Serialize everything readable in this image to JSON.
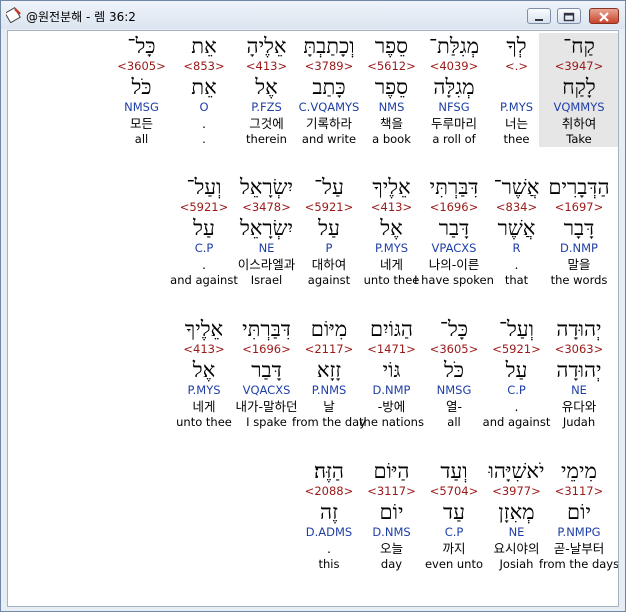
{
  "window": {
    "title": "@원전분해 - 렘 36:2",
    "buttons": [
      "minimize",
      "maximize",
      "close"
    ]
  },
  "rows": [
    [
      {
        "heb": "קַח־",
        "num": "<3947>",
        "lex": "לָקַח",
        "morph": "VQMMYS",
        "kor": "취하여",
        "eng": "Take",
        "highlight": true
      },
      {
        "heb": "לְךָ",
        "num": "<.>",
        "lex": "",
        "morph": "P.MYS",
        "kor": "너는",
        "eng": "thee"
      },
      {
        "heb": "מְגִלַּת־",
        "num": "<4039>",
        "lex": "מְגִלָּה",
        "morph": "NFSG",
        "kor": "두루마리",
        "eng": "a roll of"
      },
      {
        "heb": "סֵפֶר",
        "num": "<5612>",
        "lex": "סֵפֶר",
        "morph": "NMS",
        "kor": "책을",
        "eng": "a book"
      },
      {
        "heb": "וְכָתַבְתָּ",
        "num": "<3789>",
        "lex": "כָּתַב",
        "morph": "C.VQAMYS",
        "kor": "기록하라",
        "eng": "and write"
      },
      {
        "heb": "אֵלֶיהָ",
        "num": "<413>",
        "lex": "אֶל",
        "morph": "P.FZS",
        "kor": "그것에",
        "eng": "therein"
      },
      {
        "heb": "אֵת",
        "num": "<853>",
        "lex": "אֵת",
        "morph": "O",
        "kor": ".",
        "eng": "."
      },
      {
        "heb": "כָּל־",
        "num": "<3605>",
        "lex": "כֹּל",
        "morph": "NMSG",
        "kor": "모든",
        "eng": "all"
      }
    ],
    [
      {
        "heb": "הַדְּבָרִים",
        "num": "<1697>",
        "lex": "דָּבָר",
        "morph": "D.NMP",
        "kor": "말을",
        "eng": "the words"
      },
      {
        "heb": "אֲשֶׁר־",
        "num": "<834>",
        "lex": "אֲשֶׁר",
        "morph": "R",
        "kor": ".",
        "eng": "that"
      },
      {
        "heb": "דִּבַּרְתִּי",
        "num": "<1696>",
        "lex": "דָּבַר",
        "morph": "VPACXS",
        "kor": "나의-이른",
        "eng": "I have spoken"
      },
      {
        "heb": "אֵלֶיךָ",
        "num": "<413>",
        "lex": "אֶל",
        "morph": "P.MYS",
        "kor": "네게",
        "eng": "unto thee"
      },
      {
        "heb": "עַל־",
        "num": "<5921>",
        "lex": "עַל",
        "morph": "P",
        "kor": "대하여",
        "eng": "against"
      },
      {
        "heb": "יִשְׂרָאֵל",
        "num": "<3478>",
        "lex": "יִשְׂרָאֵל",
        "morph": "NE",
        "kor": "이스라엘과",
        "eng": "Israel"
      },
      {
        "heb": "וְעַל־",
        "num": "<5921>",
        "lex": "עַל",
        "morph": "C.P",
        "kor": ".",
        "eng": "and against"
      }
    ],
    [
      {
        "heb": "יְהוּדָה",
        "num": "<3063>",
        "lex": "יְהוּדָה",
        "morph": "NE",
        "kor": "유다와",
        "eng": "Judah"
      },
      {
        "heb": "וְעַל־",
        "num": "<5921>",
        "lex": "עַל",
        "morph": "C.P",
        "kor": ".",
        "eng": "and against"
      },
      {
        "heb": "כָּל־",
        "num": "<3605>",
        "lex": "כֹּל",
        "morph": "NMSG",
        "kor": "열-",
        "eng": "all"
      },
      {
        "heb": "הַגּוֹיִם",
        "num": "<1471>",
        "lex": "גּוֹי",
        "morph": "D.NMP",
        "kor": "-방에",
        "eng": "the nations"
      },
      {
        "heb": "מִיּוֹם",
        "num": "<2117>",
        "lex": "זָזָא",
        "morph": "P.NMS",
        "kor": "날",
        "eng": "from the day"
      },
      {
        "heb": "דִּבַּרְתִּי",
        "num": "<1696>",
        "lex": "דָּבַר",
        "morph": "VQACXS",
        "kor": "내가-말하던",
        "eng": "I spake"
      },
      {
        "heb": "אֵלֶיךָ",
        "num": "<413>",
        "lex": "אֶל",
        "morph": "P.MYS",
        "kor": "네게",
        "eng": "unto thee"
      }
    ],
    [
      {
        "heb": "מִימֵי",
        "num": "<3117>",
        "lex": "יוֹם",
        "morph": "P.NMPG",
        "kor": "곧-날부터",
        "eng": "from the days of"
      },
      {
        "heb": "יֹאשִׁיָּהוּ",
        "num": "<3977>",
        "lex": "מְאִזָן",
        "morph": "NE",
        "kor": "요시야의",
        "eng": "Josiah"
      },
      {
        "heb": "וְעַד",
        "num": "<5704>",
        "lex": "עַד",
        "morph": "C.P",
        "kor": "까지",
        "eng": "even unto"
      },
      {
        "heb": "הַיּוֹם",
        "num": "<3117>",
        "lex": "יוֹם",
        "morph": "D.NMS",
        "kor": "오늘",
        "eng": "day"
      },
      {
        "heb": "הַזֶּה׃",
        "num": "<2088>",
        "lex": "זֶה",
        "morph": "D.ADMS",
        "kor": ".",
        "eng": "this"
      }
    ]
  ]
}
